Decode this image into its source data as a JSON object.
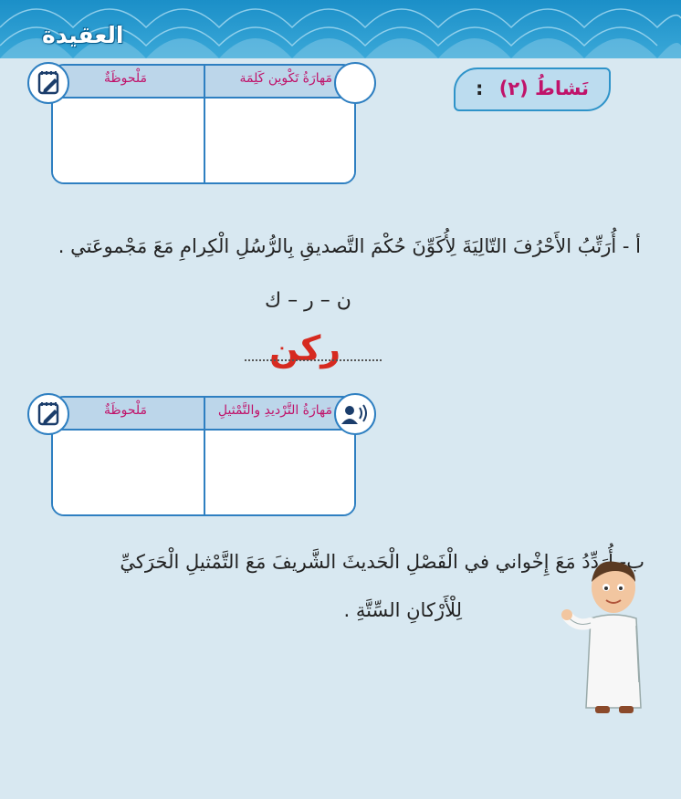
{
  "header": {
    "title": "العقيدة"
  },
  "activity": {
    "title": "نَشاطُ (٢)",
    "colon": ":"
  },
  "skill_box_1": {
    "skill": "مَهارَةُ تَكْوين كَلِمَة",
    "note": "مَلْحوظَةٌ"
  },
  "part_a": {
    "instruction": "أ - أُرَتِّبُ الأَحْرُفَ التّالِيَةَ لِأُكَوِّنَ حُكْمَ التَّصديقِ بِالرُّسُلِ الْكِرامِ مَعَ مَجْموعَتي .",
    "letters": "ن – ر – ك",
    "answer": "ركن"
  },
  "skill_box_2": {
    "skill": "مَهارَةُ التَّرْديدِ والتَّمْثيلِ",
    "note": "مَلْحوظَةٌ"
  },
  "part_b": {
    "line1": "ب- أُرَدِّدُ مَعَ إِخْواني في الْفَصْلِ الْحَديثَ الشَّريفَ مَعَ التَّمْثيلِ الْحَرَكيِّ",
    "line2": "لِلْأَرْكانِ السِّتَّةِ ."
  },
  "colors": {
    "accent": "#2e7fc1",
    "magenta": "#c0136a",
    "answer_red": "#d62a20",
    "background": "#d8e8f1"
  },
  "icons": [
    "pencil-note-icon",
    "speaker-person-icon"
  ]
}
